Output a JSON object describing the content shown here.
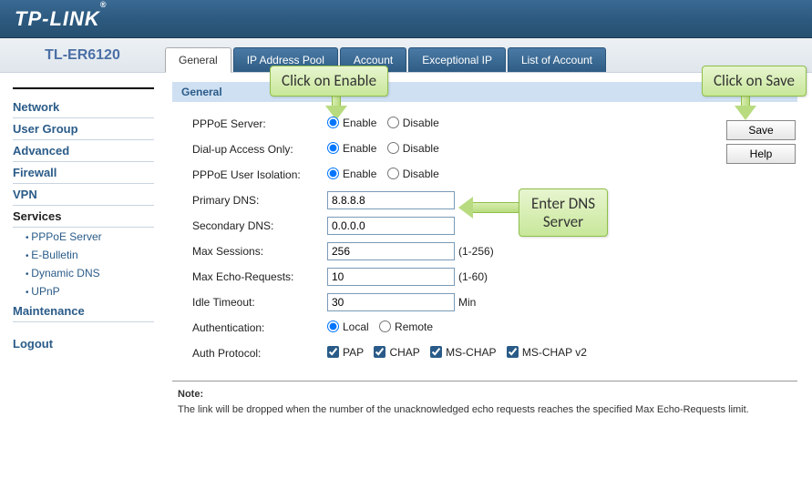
{
  "brand": "TP-LINK",
  "model": "TL-ER6120",
  "tabs": [
    "General",
    "IP Address Pool",
    "Account",
    "Exceptional IP",
    "List of Account"
  ],
  "active_tab_index": 0,
  "sidebar": {
    "items": [
      "Network",
      "User Group",
      "Advanced",
      "Firewall",
      "VPN",
      "Services"
    ],
    "subitems": [
      "PPPoE Server",
      "E-Bulletin",
      "Dynamic DNS",
      "UPnP"
    ],
    "after_items": [
      "Maintenance"
    ],
    "logout": "Logout"
  },
  "section_title": "General",
  "form": {
    "pppoe_server_label": "PPPoE Server:",
    "dial_up_label": "Dial-up Access Only:",
    "user_isolation_label": "PPPoE User Isolation:",
    "primary_dns_label": "Primary DNS:",
    "secondary_dns_label": "Secondary DNS:",
    "max_sessions_label": "Max Sessions:",
    "max_echo_label": "Max Echo-Requests:",
    "idle_timeout_label": "Idle Timeout:",
    "authentication_label": "Authentication:",
    "auth_protocol_label": "Auth Protocol:",
    "enable": "Enable",
    "disable": "Disable",
    "local": "Local",
    "remote": "Remote",
    "primary_dns": "8.8.8.8",
    "secondary_dns": "0.0.0.0",
    "max_sessions": "256",
    "max_sessions_hint": "(1-256)",
    "max_echo": "10",
    "max_echo_hint": "(1-60)",
    "idle_timeout": "30",
    "idle_timeout_hint": "Min",
    "protocols": [
      "PAP",
      "CHAP",
      "MS-CHAP",
      "MS-CHAP v2"
    ]
  },
  "buttons": {
    "save": "Save",
    "help": "Help"
  },
  "note_title": "Note:",
  "note_body": "The link will be dropped when the number of the unacknowledged echo requests reaches the specified Max Echo-Requests limit.",
  "callouts": {
    "enable": "Click on Enable",
    "dns_line1": "Enter DNS",
    "dns_line2": "Server",
    "save": "Click on Save"
  }
}
